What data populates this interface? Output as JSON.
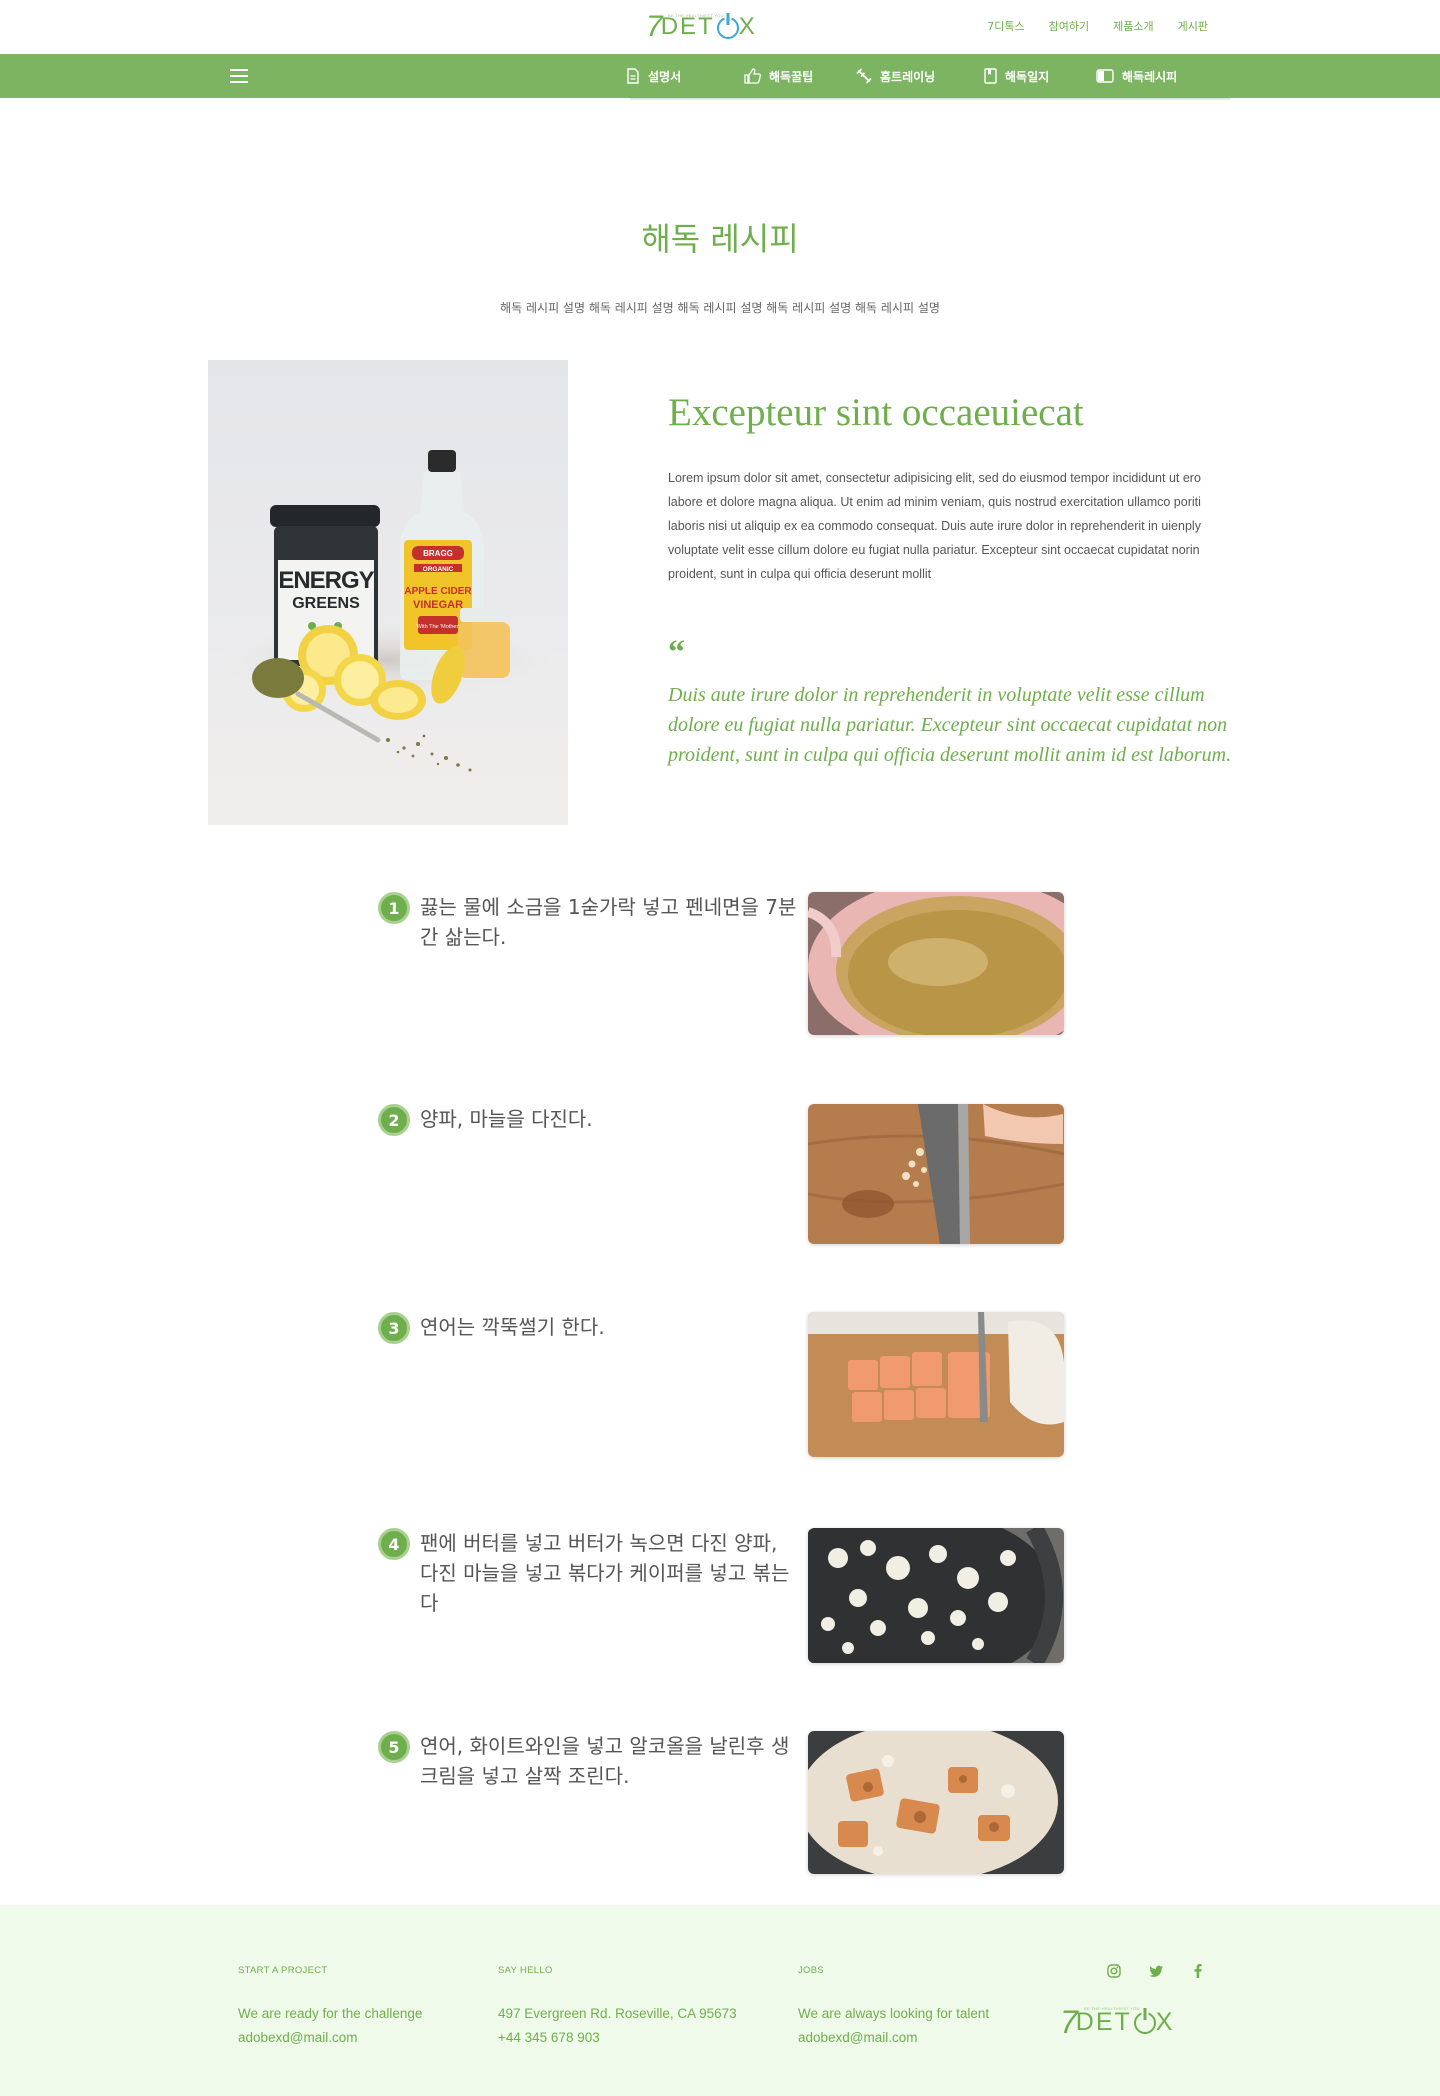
{
  "brand": {
    "seven": "7",
    "word_a": "DET",
    "word_b": "X",
    "tagline": "BE THE HEALTHIEST YOU"
  },
  "top_links": [
    "7디톡스",
    "참여하기",
    "제품소개",
    "게시판"
  ],
  "nav": [
    {
      "label": "설명서",
      "icon": "document-icon"
    },
    {
      "label": "해독꿀팁",
      "icon": "thumbs-up-icon"
    },
    {
      "label": "홈트레이닝",
      "icon": "dumbbell-icon"
    },
    {
      "label": "해독일지",
      "icon": "journal-icon"
    },
    {
      "label": "해독레시피",
      "icon": "recipe-book-icon"
    }
  ],
  "page": {
    "title": "해독 레시피",
    "description": "해독 레시피 설명 해독 레시피 설명 해독 레시피 설명 해독 레시피 설명 해독 레시피 설명"
  },
  "feature": {
    "title": "Excepteur sint occaeuiecat",
    "body": "Lorem ipsum dolor sit amet, consectetur adipisicing elit, sed do eiusmod tempor incididunt ut ero labore et dolore magna aliqua. Ut enim ad minim veniam, quis nostrud exercitation ullamco poriti laboris nisi ut aliquip ex ea commodo consequat. Duis aute irure dolor in reprehenderit in uienply voluptate velit esse cillum dolore eu fugiat nulla pariatur. Excepteur sint occaecat cupidatat norin proident, sunt in culpa qui officia deserunt mollit",
    "quote_mark": "“",
    "quote": "Duis aute irure dolor in reprehenderit in voluptate velit esse cillum dolore eu fugiat nulla pariatur. Excepteur sint occaecat cupidatat non proident, sunt in culpa qui officia deserunt mollit anim id est laborum.",
    "image_text": {
      "energy": "ENERGY",
      "greens": "GREENS",
      "bragg": "BRAGG",
      "organic": "ORGANIC",
      "apple": "APPLE CIDER",
      "vinegar": "VINEGAR",
      "mother": "With The 'Mother'"
    }
  },
  "steps": [
    {
      "num": "1",
      "text": "끓는 물에 소금을 1숟가락 넣고 펜네면을 7분간 삶는다."
    },
    {
      "num": "2",
      "text": "양파, 마늘을 다진다."
    },
    {
      "num": "3",
      "text": "연어는 깍뚝썰기 한다."
    },
    {
      "num": "4",
      "text": "팬에 버터를 넣고 버터가 녹으면 다진 양파, 다진 마늘을 넣고 볶다가 케이퍼를 넣고 볶는다"
    },
    {
      "num": "5",
      "text": "연어, 화이트와인을 넣고 알코올을 날린후 생크림을 넣고 살짝 조린다."
    }
  ],
  "footer": {
    "col1": {
      "heading": "START A PROJECT",
      "line1": "We are ready for the challenge",
      "line2": "adobexd@mail.com"
    },
    "col2": {
      "heading": "SAY HELLO",
      "line1": "497 Evergreen Rd. Roseville, CA 95673",
      "line2": "+44 345 678 903"
    },
    "col3": {
      "heading": "JOBS",
      "line1": "We are always looking for talent",
      "line2": "adobexd@mail.com"
    },
    "socials": [
      "instagram-icon",
      "twitter-icon",
      "facebook-icon"
    ]
  },
  "colors": {
    "brand_green": "#6fae4d",
    "nav_green": "#7cb462",
    "footer_bg": "#f0faea",
    "power_blue": "#3aa7d8"
  }
}
